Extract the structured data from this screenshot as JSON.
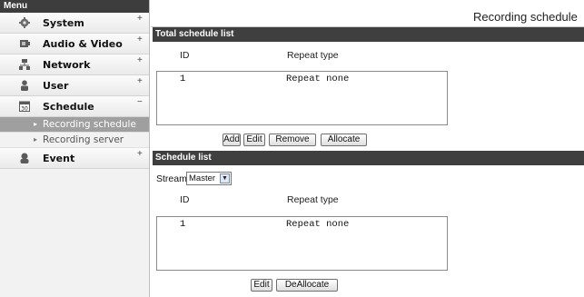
{
  "sidebar": {
    "header": "Menu",
    "items": [
      {
        "label": "System",
        "icon": "gear-icon",
        "toggle": "+"
      },
      {
        "label": "Audio & Video",
        "icon": "camera-icon",
        "toggle": "+"
      },
      {
        "label": "Network",
        "icon": "network-icon",
        "toggle": "+"
      },
      {
        "label": "User",
        "icon": "user-icon",
        "toggle": "+"
      },
      {
        "label": "Schedule",
        "icon": "calendar-icon",
        "toggle": "−"
      },
      {
        "label": "Event",
        "icon": "event-icon",
        "toggle": "+"
      }
    ],
    "sub_items": [
      {
        "label": "Recording schedule",
        "active": true
      },
      {
        "label": "Recording server",
        "active": false
      }
    ]
  },
  "page": {
    "title": "Recording schedule"
  },
  "total_schedule": {
    "header": "Total schedule list",
    "col_id": "ID",
    "col_repeat": "Repeat type",
    "rows": [
      {
        "id": "1",
        "repeat": "Repeat none"
      }
    ],
    "buttons": {
      "add": "Add",
      "edit": "Edit",
      "remove": "Remove",
      "allocate": "Allocate"
    }
  },
  "schedule_list": {
    "header": "Schedule list",
    "stream_label": "Stream",
    "stream_value": "Master",
    "col_id": "ID",
    "col_repeat": "Repeat type",
    "rows": [
      {
        "id": "1",
        "repeat": "Repeat none"
      }
    ],
    "buttons": {
      "edit": "Edit",
      "deallocate": "DeAllocate"
    }
  }
}
